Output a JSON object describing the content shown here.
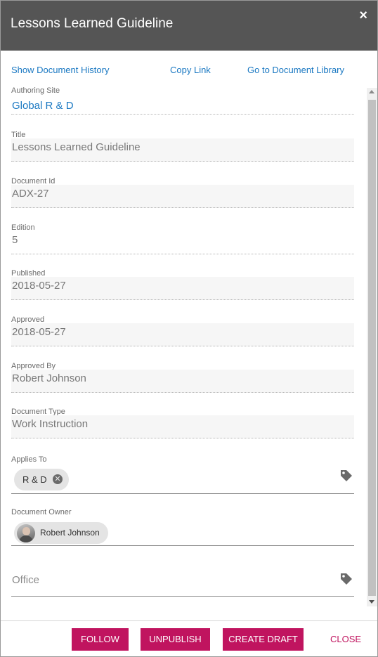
{
  "header": {
    "title": "Lessons Learned Guideline",
    "close_icon": "×"
  },
  "links": {
    "history": "Show Document History",
    "copy": "Copy Link",
    "library": "Go to Document Library"
  },
  "fields": {
    "authoring_site": {
      "label": "Authoring Site",
      "value": "Global R & D"
    },
    "title": {
      "label": "Title",
      "value": "Lessons Learned Guideline"
    },
    "document_id": {
      "label": "Document Id",
      "value": "ADX-27"
    },
    "edition": {
      "label": "Edition",
      "value": "5"
    },
    "published": {
      "label": "Published",
      "value": "2018-05-27"
    },
    "approved": {
      "label": "Approved",
      "value": "2018-05-27"
    },
    "approved_by": {
      "label": "Approved By",
      "value": "Robert Johnson"
    },
    "document_type": {
      "label": "Document Type",
      "value": "Work Instruction"
    },
    "applies_to": {
      "label": "Applies To",
      "chip": "R & D",
      "chip_remove": "✕"
    },
    "document_owner": {
      "label": "Document Owner",
      "chip": "Robert Johnson"
    },
    "office": {
      "placeholder": "Office"
    }
  },
  "footer": {
    "follow": "FOLLOW",
    "unpublish": "UNPUBLISH",
    "create_draft": "CREATE DRAFT",
    "close": "CLOSE"
  },
  "colors": {
    "header_bg": "#555555",
    "link": "#1a78c2",
    "accent": "#c0145f"
  },
  "icons": {
    "close": "close-icon",
    "tag": "tag-icon",
    "remove": "remove-chip-icon",
    "avatar": "user-avatar"
  }
}
